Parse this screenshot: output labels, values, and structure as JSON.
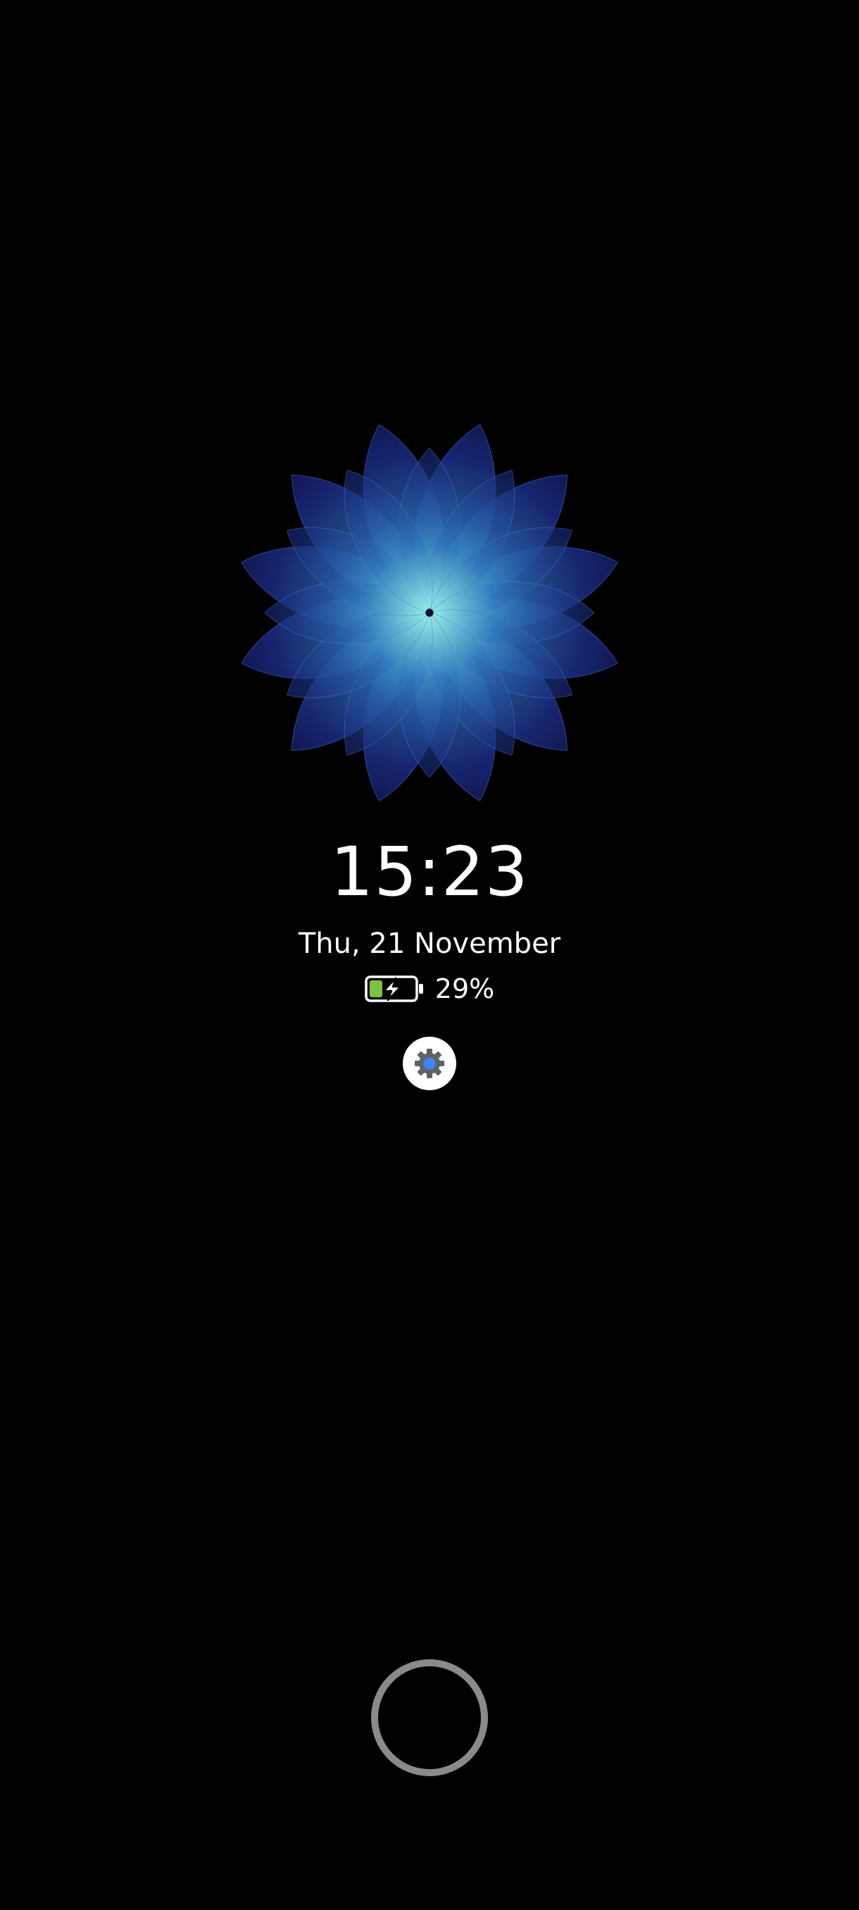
{
  "lockscreen": {
    "time": "15:23",
    "date": "Thu, 21 November",
    "battery": {
      "percent_label": "29%",
      "level": 0.29,
      "charging": true,
      "icon": "battery-charging-icon"
    },
    "notification_icons": [
      "settings-gear-icon"
    ],
    "wallpaper_icon": "flower-icon",
    "unlock_icon": "fingerprint-ring-icon"
  },
  "colors": {
    "background": "#000000",
    "text": "#ffffff",
    "battery_fill": "#7cc342",
    "petal_outer": "#1b2a86",
    "petal_mid": "#2f6fb8",
    "petal_inner": "#7ee3dc",
    "ring": "#8a8a8a"
  }
}
